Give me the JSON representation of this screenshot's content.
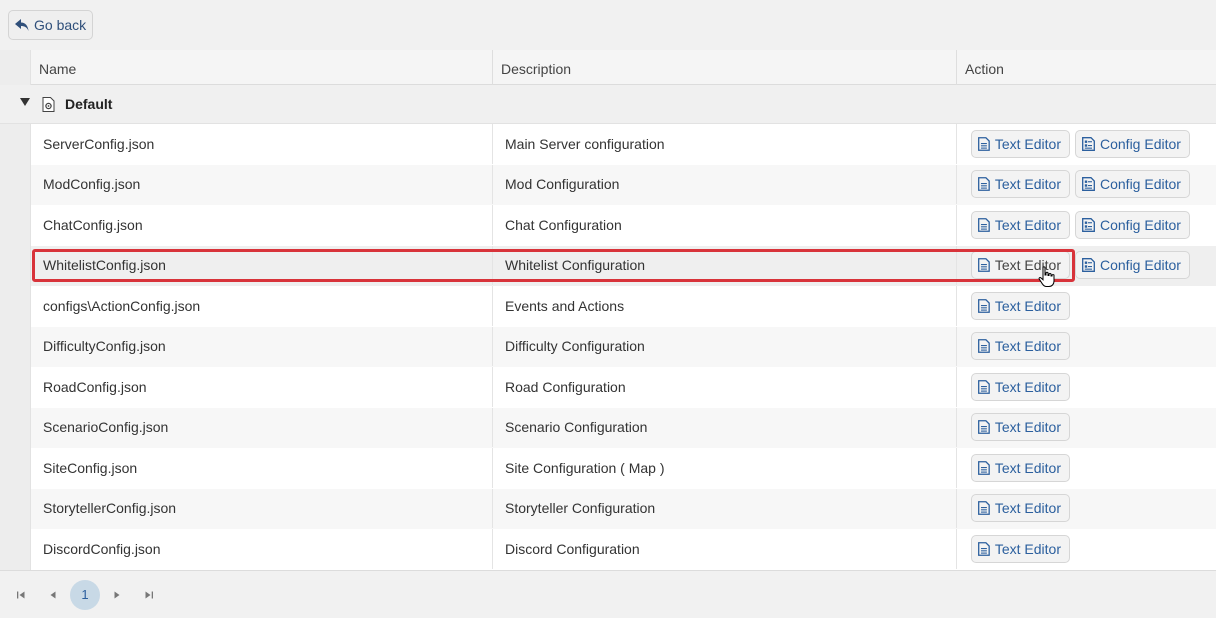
{
  "toolbar": {
    "go_back_label": "Go back"
  },
  "table": {
    "headers": {
      "name": "Name",
      "description": "Description",
      "action": "Action"
    },
    "group": {
      "label": "Default"
    },
    "buttons": {
      "text_editor": "Text Editor",
      "config_editor": "Config Editor"
    },
    "rows": [
      {
        "name": "ServerConfig.json",
        "description": "Main Server configuration",
        "has_config_editor": true
      },
      {
        "name": "ModConfig.json",
        "description": "Mod Configuration",
        "has_config_editor": true
      },
      {
        "name": "ChatConfig.json",
        "description": "Chat Configuration",
        "has_config_editor": true
      },
      {
        "name": "WhitelistConfig.json",
        "description": "Whitelist Configuration",
        "has_config_editor": true,
        "highlighted": true
      },
      {
        "name": "configs\\ActionConfig.json",
        "description": "Events and Actions",
        "has_config_editor": false
      },
      {
        "name": "DifficultyConfig.json",
        "description": "Difficulty Configuration",
        "has_config_editor": false
      },
      {
        "name": "RoadConfig.json",
        "description": "Road Configuration",
        "has_config_editor": false
      },
      {
        "name": "ScenarioConfig.json",
        "description": "Scenario Configuration",
        "has_config_editor": false
      },
      {
        "name": "SiteConfig.json",
        "description": "Site Configuration ( Map )",
        "has_config_editor": false
      },
      {
        "name": "StorytellerConfig.json",
        "description": "Storyteller Configuration",
        "has_config_editor": false
      },
      {
        "name": "DiscordConfig.json",
        "description": "Discord Configuration",
        "has_config_editor": false
      }
    ]
  },
  "pager": {
    "current_page": "1"
  },
  "colors": {
    "accent": "#2b5f9e",
    "highlight": "#d8333a",
    "page_active": "#c8d9e6"
  }
}
